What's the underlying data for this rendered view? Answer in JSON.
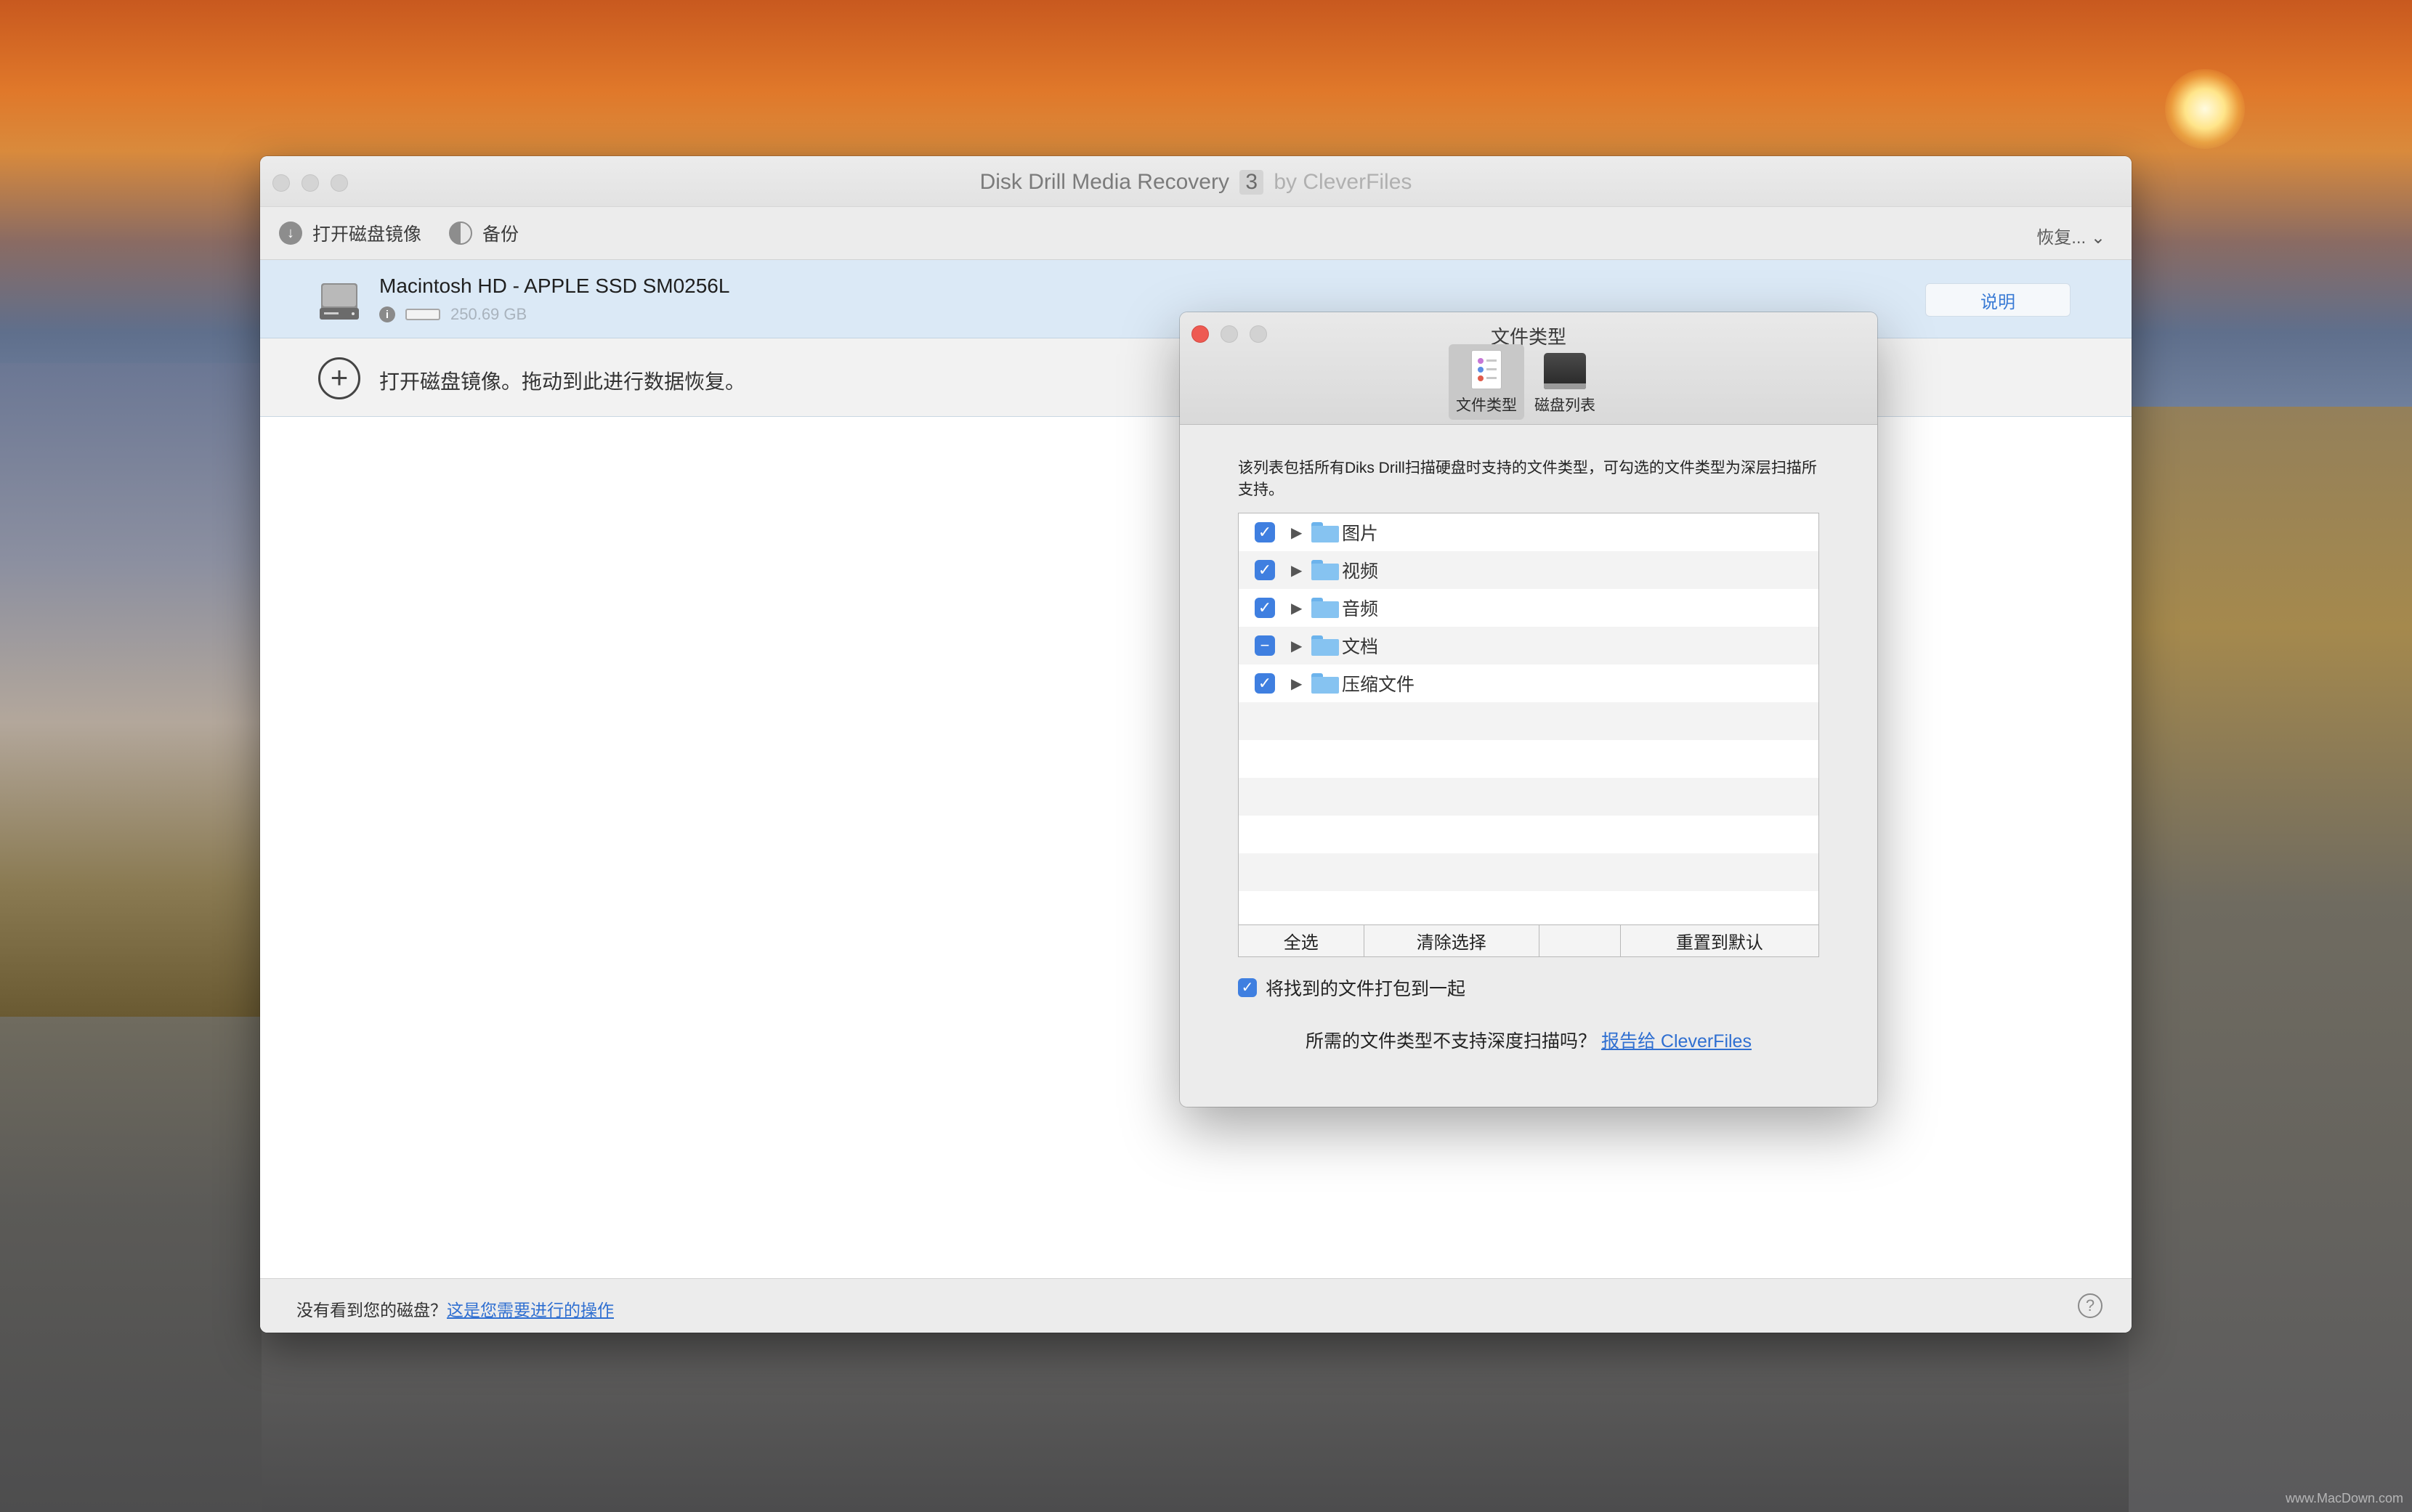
{
  "window": {
    "title": "Disk Drill Media Recovery",
    "version": "3",
    "by": "by CleverFiles"
  },
  "toolbar": {
    "open_disk_image": "打开磁盘镜像",
    "backup": "备份",
    "recover_menu": "恢复... ⌄"
  },
  "disk": {
    "name": "Macintosh HD -  APPLE SSD SM0256L",
    "size": "250.69 GB",
    "explain_button": "说明"
  },
  "open_image_row": {
    "text": "打开磁盘镜像。拖动到此进行数据恢复。"
  },
  "footer": {
    "question": "没有看到您的磁盘？",
    "link": "这是您需要进行的操作"
  },
  "dialog": {
    "title": "文件类型",
    "tabs": [
      {
        "label": "文件类型",
        "active": true
      },
      {
        "label": "磁盘列表",
        "active": false
      }
    ],
    "description": "该列表包括所有Diks  Drill扫描硬盘时支持的文件类型，可勾选的文件类型为深层扫描所支持。",
    "file_types": [
      {
        "label": "图片",
        "state": "checked"
      },
      {
        "label": "视频",
        "state": "checked"
      },
      {
        "label": "音频",
        "state": "checked"
      },
      {
        "label": "文档",
        "state": "mixed"
      },
      {
        "label": "压缩文件",
        "state": "checked"
      }
    ],
    "buttons": {
      "select_all": "全选",
      "clear_selection": "清除选择",
      "blank": "",
      "reset_default": "重置到默认"
    },
    "bundle_checkbox": "将找到的文件打包到一起",
    "report_question": "所需的文件类型不支持深度扫描吗？",
    "report_link": "报告给 CleverFiles"
  },
  "watermark": "www.MacDown.com",
  "colors": {
    "accent": "#3f7fe0",
    "link": "#2f6fd1",
    "selected_row": "#dbe9f6",
    "close_button": "#ee5a52"
  }
}
